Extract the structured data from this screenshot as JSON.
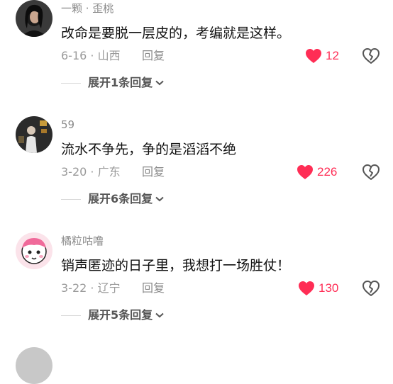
{
  "colors": {
    "like": "#ff2d55",
    "username": "#8a8a8a",
    "content": "#111111",
    "meta": "#9a9a9a",
    "expand": "#555555"
  },
  "icons": {
    "like": "heart-filled-icon",
    "dislike": "broken-heart-icon",
    "expand": "chevron-down-icon"
  },
  "comments": [
    {
      "username": "一颗 · 歪桃",
      "text": "改命是要脱一层皮的，考编就是这样。",
      "meta": "6-16 · 山西",
      "reply_label": "回复",
      "like_count": "12",
      "expand_label": "展开1条回复"
    },
    {
      "username": "59",
      "text": "流水不争先，争的是滔滔不绝",
      "meta": "3-20 · 广东",
      "reply_label": "回复",
      "like_count": "226",
      "expand_label": "展开6条回复"
    },
    {
      "username": "橘粒咕噜",
      "text": "销声匿迹的日子里，我想打一场胜仗！",
      "meta": "3-22 · 辽宁",
      "reply_label": "回复",
      "like_count": "130",
      "expand_label": "展开5条回复"
    }
  ]
}
